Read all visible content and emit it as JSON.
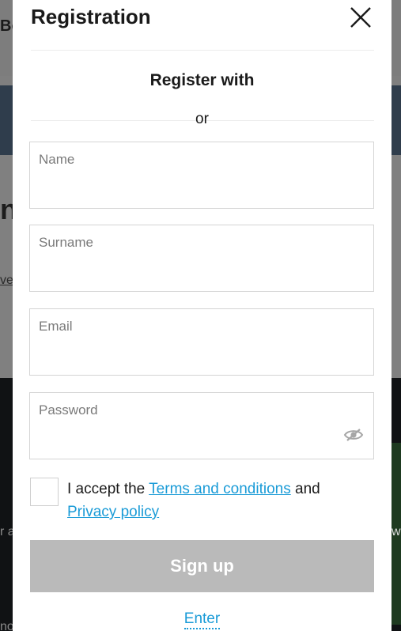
{
  "background": {
    "brand_fragment": "Bo",
    "big_letter": "n",
    "link_fragment": "ver",
    "edge_left_1": "r a",
    "edge_left_2": "no",
    "edge_right_1": "w"
  },
  "modal": {
    "title": "Registration",
    "register_with": "Register with",
    "or": "or",
    "fields": {
      "name": {
        "placeholder": "Name"
      },
      "surname": {
        "placeholder": "Surname"
      },
      "email": {
        "placeholder": "Email"
      },
      "password": {
        "placeholder": "Password"
      }
    },
    "consent": {
      "prefix": "I accept the ",
      "terms_link": "Terms and conditions",
      "middle": " and ",
      "privacy_link": "Privacy policy"
    },
    "signup_label": "Sign up",
    "enter_label": "Enter"
  },
  "colors": {
    "link": "#1a9bd7",
    "button_disabled": "#bababa",
    "overlay": "#7f7f7f"
  },
  "icons": {
    "close": "close-icon",
    "password_toggle": "eye-slash-icon"
  }
}
